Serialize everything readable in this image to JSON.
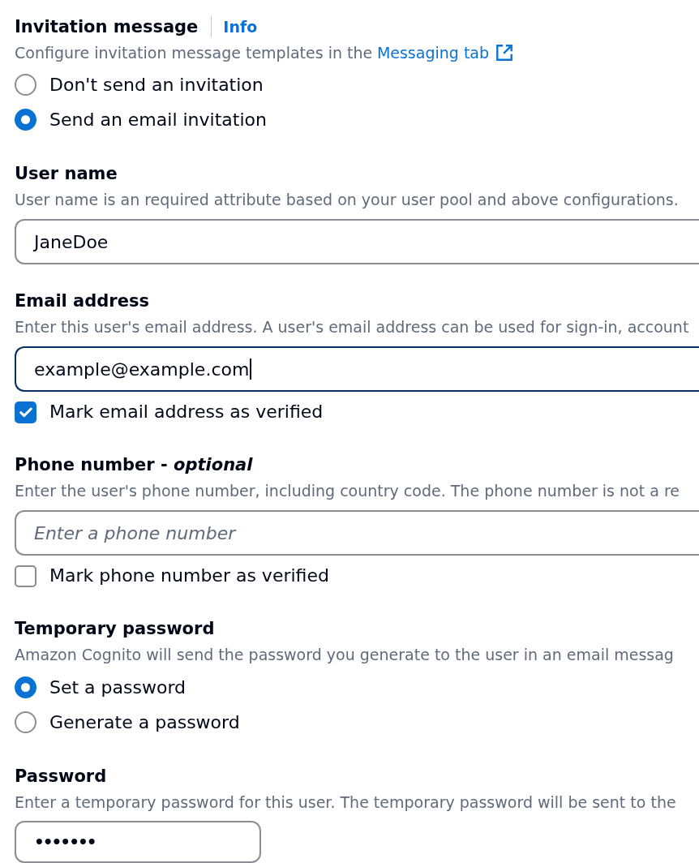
{
  "sections": [
    {
      "kind": "radio_group",
      "heading": "Invitation message",
      "info_link": "Info",
      "description": "Configure invitation message templates in the",
      "description_link": "Messaging tab",
      "options": [
        {
          "label": "Don't send an invitation",
          "selected": false
        },
        {
          "label": "Send an email invitation",
          "selected": true
        }
      ]
    },
    {
      "kind": "text_field",
      "heading": "User name",
      "description": "User name is an required attribute based on your user pool and above configurations.",
      "value": "JaneDoe",
      "focused": false
    },
    {
      "kind": "text_field",
      "heading": "Email address",
      "description": "Enter this user's email address. A user's email address can be used for sign-in, account",
      "value": "example@example.com",
      "focused": true,
      "checkbox": {
        "label": "Mark email address as verified",
        "checked": true
      }
    },
    {
      "kind": "text_field",
      "heading": "Phone number - *optional*",
      "description": "Enter the user's phone number, including country code. The phone number is not a re",
      "placeholder": "Enter a phone number",
      "focused": false,
      "checkbox": {
        "label": "Mark phone number as verified",
        "checked": false
      }
    },
    {
      "kind": "radio_group",
      "heading": "Temporary password",
      "description": "Amazon Cognito will send the password you generate to the user in an email messag",
      "options": [
        {
          "label": "Set a password",
          "selected": true
        },
        {
          "label": "Generate a password",
          "selected": false
        }
      ]
    },
    {
      "kind": "password_field",
      "heading": "Password",
      "description": "Enter a temporary password for this user. The temporary password will be sent to the",
      "value": "•••••••",
      "focused": false
    }
  ]
}
